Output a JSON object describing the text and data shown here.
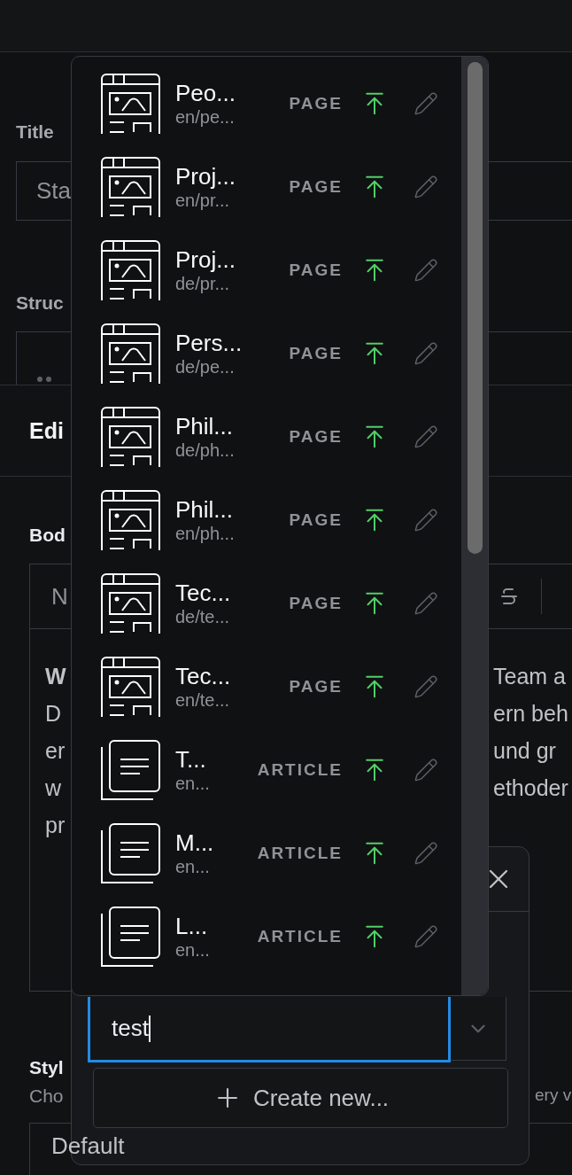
{
  "form": {
    "title_label": "Title",
    "title_value": "Sta",
    "structure_label": "Struc"
  },
  "edit_panel": {
    "title": "Edi",
    "body_label": "Bod",
    "toolbar_text": "N",
    "body_lines": [
      {
        "left": "W",
        "right": "Team a",
        "bold_left": true
      },
      {
        "left": "D",
        "right": "ern beh",
        "bold_left": false
      },
      {
        "left": "er",
        "right": "und gr",
        "bold_left": false
      },
      {
        "left": "w",
        "right": "ethoder",
        "bold_left": false
      },
      {
        "left": "pr",
        "bold_left": false
      }
    ],
    "style_label": "Styl",
    "style_hint_left": "Cho",
    "style_hint_right": "ery v",
    "style_value": "Default"
  },
  "dialog": {
    "search": {
      "value": "test"
    },
    "create_button": "Create new..."
  },
  "dropdown": {
    "items": [
      {
        "kind": "page",
        "title": "Peo...",
        "path": "en/pe...",
        "type": "PAGE"
      },
      {
        "kind": "page",
        "title": "Proj...",
        "path": "en/pr...",
        "type": "PAGE"
      },
      {
        "kind": "page",
        "title": "Proj...",
        "path": "de/pr...",
        "type": "PAGE"
      },
      {
        "kind": "page",
        "title": "Pers...",
        "path": "de/pe...",
        "type": "PAGE"
      },
      {
        "kind": "page",
        "title": "Phil...",
        "path": "de/ph...",
        "type": "PAGE"
      },
      {
        "kind": "page",
        "title": "Phil...",
        "path": "en/ph...",
        "type": "PAGE"
      },
      {
        "kind": "page",
        "title": "Tec...",
        "path": "de/te...",
        "type": "PAGE"
      },
      {
        "kind": "page",
        "title": "Tec...",
        "path": "en/te...",
        "type": "PAGE"
      },
      {
        "kind": "article",
        "title": "T...",
        "path": "en...",
        "type": "ARTICLE"
      },
      {
        "kind": "article",
        "title": "M...",
        "path": "en...",
        "type": "ARTICLE"
      },
      {
        "kind": "article",
        "title": "L...",
        "path": "en...",
        "type": "ARTICLE"
      }
    ]
  }
}
